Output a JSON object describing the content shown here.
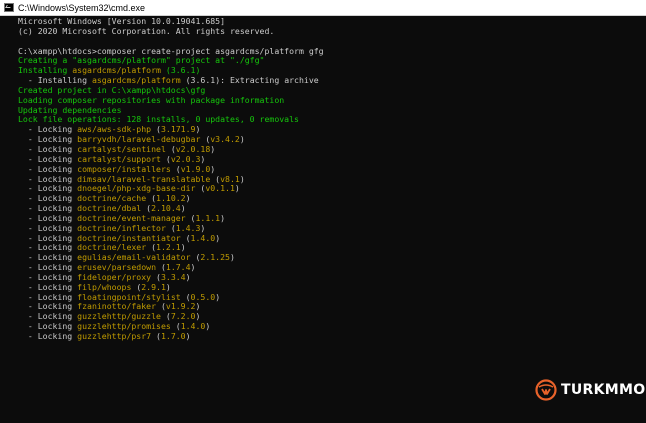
{
  "window": {
    "title": "C:\\Windows\\System32\\cmd.exe"
  },
  "colors": {
    "text": "#cccccc",
    "info": "#16c60c",
    "package": "#c19c00",
    "logo": "#e8622a"
  },
  "console": {
    "lines": [
      [
        {
          "t": "Microsoft Windows [Version 10.0.19041.685]",
          "c": "w"
        }
      ],
      [
        {
          "t": "(c) 2020 Microsoft Corporation. All rights reserved.",
          "c": "w"
        }
      ],
      [
        {
          "t": "",
          "c": "w"
        }
      ],
      [
        {
          "t": "C:\\xampp\\htdocs>composer create-project asgardcms/platform gfg",
          "c": "w"
        }
      ],
      [
        {
          "t": "Creating a \"asgardcms/platform\" project at \"./gfg\"",
          "c": "g"
        }
      ],
      [
        {
          "t": "Installing ",
          "c": "g"
        },
        {
          "t": "asgardcms/platform",
          "c": "y"
        },
        {
          "t": " (3.6.1)",
          "c": "g"
        }
      ],
      [
        {
          "t": "  - Installing ",
          "c": "w"
        },
        {
          "t": "asgardcms/platform",
          "c": "y"
        },
        {
          "t": " (3.6.1): Extracting archive",
          "c": "w"
        }
      ],
      [
        {
          "t": "Created project in C:\\xampp\\htdocs\\gfg",
          "c": "g"
        }
      ],
      [
        {
          "t": "Loading composer repositories with package information",
          "c": "g"
        }
      ],
      [
        {
          "t": "Updating dependencies",
          "c": "g"
        }
      ],
      [
        {
          "t": "Lock file operations: 128 installs, 0 updates, 0 removals",
          "c": "g"
        }
      ],
      [
        {
          "t": "  - Locking ",
          "c": "w"
        },
        {
          "t": "aws/aws-sdk-php",
          "c": "y"
        },
        {
          "t": " (",
          "c": "w"
        },
        {
          "t": "3.171.9",
          "c": "y"
        },
        {
          "t": ")",
          "c": "w"
        }
      ],
      [
        {
          "t": "  - Locking ",
          "c": "w"
        },
        {
          "t": "barryvdh/laravel-debugbar",
          "c": "y"
        },
        {
          "t": " (",
          "c": "w"
        },
        {
          "t": "v3.4.2",
          "c": "y"
        },
        {
          "t": ")",
          "c": "w"
        }
      ],
      [
        {
          "t": "  - Locking ",
          "c": "w"
        },
        {
          "t": "cartalyst/sentinel",
          "c": "y"
        },
        {
          "t": " (",
          "c": "w"
        },
        {
          "t": "v2.0.18",
          "c": "y"
        },
        {
          "t": ")",
          "c": "w"
        }
      ],
      [
        {
          "t": "  - Locking ",
          "c": "w"
        },
        {
          "t": "cartalyst/support",
          "c": "y"
        },
        {
          "t": " (",
          "c": "w"
        },
        {
          "t": "v2.0.3",
          "c": "y"
        },
        {
          "t": ")",
          "c": "w"
        }
      ],
      [
        {
          "t": "  - Locking ",
          "c": "w"
        },
        {
          "t": "composer/installers",
          "c": "y"
        },
        {
          "t": " (",
          "c": "w"
        },
        {
          "t": "v1.9.0",
          "c": "y"
        },
        {
          "t": ")",
          "c": "w"
        }
      ],
      [
        {
          "t": "  - Locking ",
          "c": "w"
        },
        {
          "t": "dimsav/laravel-translatable",
          "c": "y"
        },
        {
          "t": " (",
          "c": "w"
        },
        {
          "t": "v8.1",
          "c": "y"
        },
        {
          "t": ")",
          "c": "w"
        }
      ],
      [
        {
          "t": "  - Locking ",
          "c": "w"
        },
        {
          "t": "dnoegel/php-xdg-base-dir",
          "c": "y"
        },
        {
          "t": " (",
          "c": "w"
        },
        {
          "t": "v0.1.1",
          "c": "y"
        },
        {
          "t": ")",
          "c": "w"
        }
      ],
      [
        {
          "t": "  - Locking ",
          "c": "w"
        },
        {
          "t": "doctrine/cache",
          "c": "y"
        },
        {
          "t": " (",
          "c": "w"
        },
        {
          "t": "1.10.2",
          "c": "y"
        },
        {
          "t": ")",
          "c": "w"
        }
      ],
      [
        {
          "t": "  - Locking ",
          "c": "w"
        },
        {
          "t": "doctrine/dbal",
          "c": "y"
        },
        {
          "t": " (",
          "c": "w"
        },
        {
          "t": "2.10.4",
          "c": "y"
        },
        {
          "t": ")",
          "c": "w"
        }
      ],
      [
        {
          "t": "  - Locking ",
          "c": "w"
        },
        {
          "t": "doctrine/event-manager",
          "c": "y"
        },
        {
          "t": " (",
          "c": "w"
        },
        {
          "t": "1.1.1",
          "c": "y"
        },
        {
          "t": ")",
          "c": "w"
        }
      ],
      [
        {
          "t": "  - Locking ",
          "c": "w"
        },
        {
          "t": "doctrine/inflector",
          "c": "y"
        },
        {
          "t": " (",
          "c": "w"
        },
        {
          "t": "1.4.3",
          "c": "y"
        },
        {
          "t": ")",
          "c": "w"
        }
      ],
      [
        {
          "t": "  - Locking ",
          "c": "w"
        },
        {
          "t": "doctrine/instantiator",
          "c": "y"
        },
        {
          "t": " (",
          "c": "w"
        },
        {
          "t": "1.4.0",
          "c": "y"
        },
        {
          "t": ")",
          "c": "w"
        }
      ],
      [
        {
          "t": "  - Locking ",
          "c": "w"
        },
        {
          "t": "doctrine/lexer",
          "c": "y"
        },
        {
          "t": " (",
          "c": "w"
        },
        {
          "t": "1.2.1",
          "c": "y"
        },
        {
          "t": ")",
          "c": "w"
        }
      ],
      [
        {
          "t": "  - Locking ",
          "c": "w"
        },
        {
          "t": "egulias/email-validator",
          "c": "y"
        },
        {
          "t": " (",
          "c": "w"
        },
        {
          "t": "2.1.25",
          "c": "y"
        },
        {
          "t": ")",
          "c": "w"
        }
      ],
      [
        {
          "t": "  - Locking ",
          "c": "w"
        },
        {
          "t": "erusev/parsedown",
          "c": "y"
        },
        {
          "t": " (",
          "c": "w"
        },
        {
          "t": "1.7.4",
          "c": "y"
        },
        {
          "t": ")",
          "c": "w"
        }
      ],
      [
        {
          "t": "  - Locking ",
          "c": "w"
        },
        {
          "t": "fideloper/proxy",
          "c": "y"
        },
        {
          "t": " (",
          "c": "w"
        },
        {
          "t": "3.3.4",
          "c": "y"
        },
        {
          "t": ")",
          "c": "w"
        }
      ],
      [
        {
          "t": "  - Locking ",
          "c": "w"
        },
        {
          "t": "filp/whoops",
          "c": "y"
        },
        {
          "t": " (",
          "c": "w"
        },
        {
          "t": "2.9.1",
          "c": "y"
        },
        {
          "t": ")",
          "c": "w"
        }
      ],
      [
        {
          "t": "  - Locking ",
          "c": "w"
        },
        {
          "t": "floatingpoint/stylist",
          "c": "y"
        },
        {
          "t": " (",
          "c": "w"
        },
        {
          "t": "0.5.0",
          "c": "y"
        },
        {
          "t": ")",
          "c": "w"
        }
      ],
      [
        {
          "t": "  - Locking ",
          "c": "w"
        },
        {
          "t": "fzaninotto/faker",
          "c": "y"
        },
        {
          "t": " (",
          "c": "w"
        },
        {
          "t": "v1.9.2",
          "c": "y"
        },
        {
          "t": ")",
          "c": "w"
        }
      ],
      [
        {
          "t": "  - Locking ",
          "c": "w"
        },
        {
          "t": "guzzlehttp/guzzle",
          "c": "y"
        },
        {
          "t": " (",
          "c": "w"
        },
        {
          "t": "7.2.0",
          "c": "y"
        },
        {
          "t": ")",
          "c": "w"
        }
      ],
      [
        {
          "t": "  - Locking ",
          "c": "w"
        },
        {
          "t": "guzzlehttp/promises",
          "c": "y"
        },
        {
          "t": " (",
          "c": "w"
        },
        {
          "t": "1.4.0",
          "c": "y"
        },
        {
          "t": ")",
          "c": "w"
        }
      ],
      [
        {
          "t": "  - Locking ",
          "c": "w"
        },
        {
          "t": "guzzlehttp/psr7",
          "c": "y"
        },
        {
          "t": " (",
          "c": "w"
        },
        {
          "t": "1.7.0",
          "c": "y"
        },
        {
          "t": ")",
          "c": "w"
        }
      ]
    ]
  },
  "watermark": {
    "text": "TURKMMO",
    "icon": "turkmmo-logo-icon"
  }
}
